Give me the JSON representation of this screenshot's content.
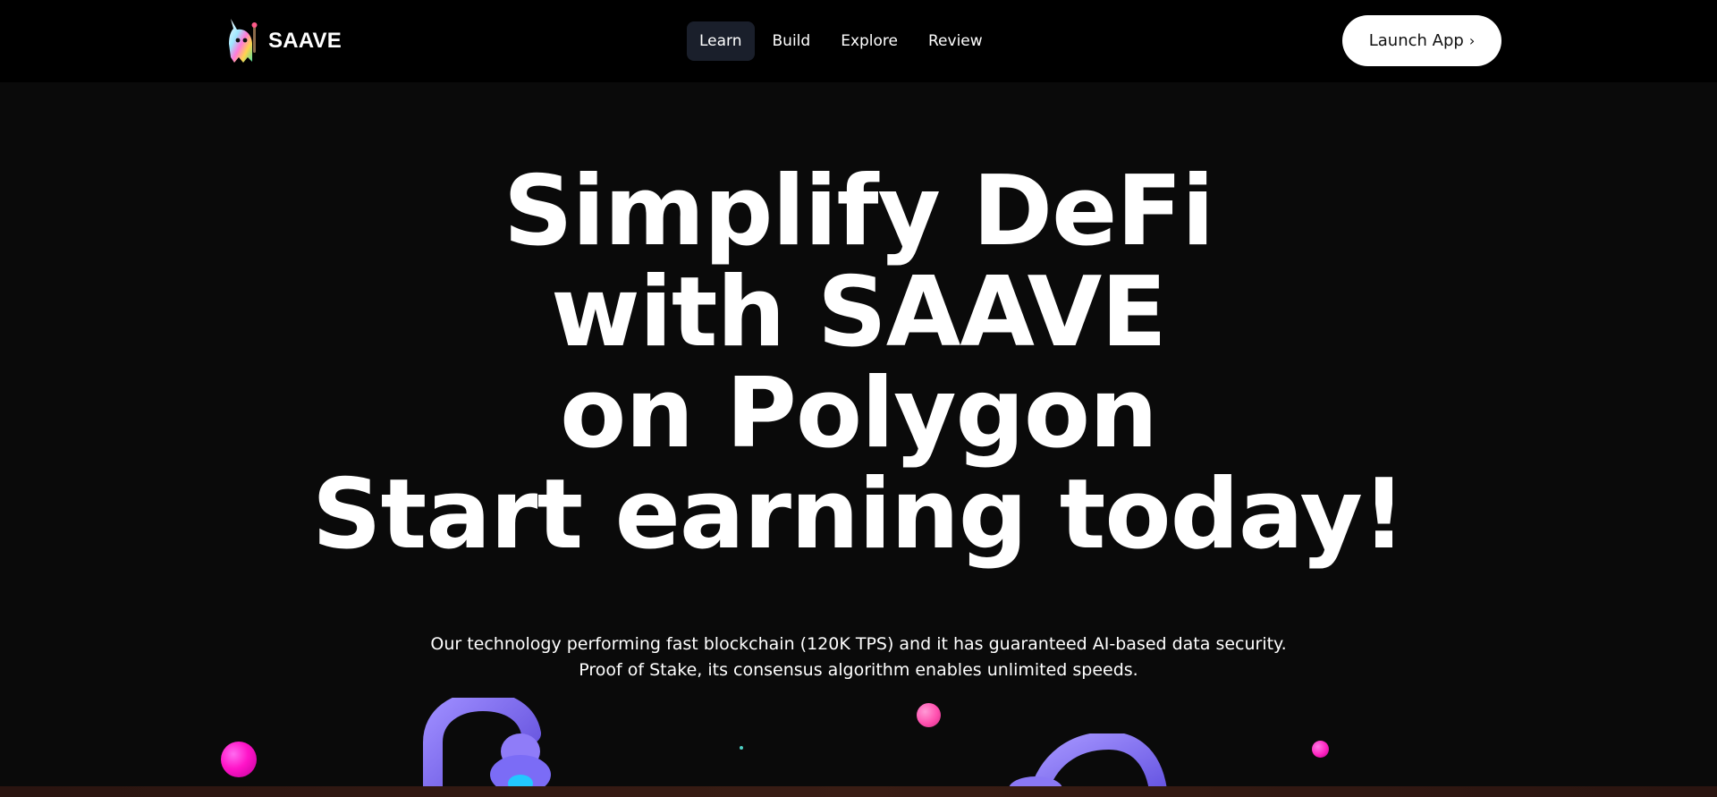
{
  "brand": {
    "name": "SAAVE",
    "logo_icon": "ghost-logo-icon"
  },
  "nav": {
    "items": [
      {
        "label": "Learn",
        "active": true
      },
      {
        "label": "Build",
        "active": false
      },
      {
        "label": "Explore",
        "active": false
      },
      {
        "label": "Review",
        "active": false
      }
    ],
    "cta": {
      "label": "Launch App",
      "chevron": "›"
    }
  },
  "hero": {
    "title_lines": [
      "Simplify DeFi",
      "with SAAVE",
      "on Polygon",
      "Start earning today!"
    ],
    "subtitle_lines": [
      "Our technology performing fast blockchain (120K TPS) and it has guaranteed AI-based data security.",
      "Proof of Stake, its consensus algorithm enables unlimited speeds."
    ]
  },
  "colors": {
    "background": "#0a0a0a",
    "nav_background": "#000000",
    "active_tab": "#1a1f2b",
    "cta_background": "#ffffff",
    "orb_magenta": "#ff14c8",
    "tube_purple": "#7b6cf6"
  }
}
